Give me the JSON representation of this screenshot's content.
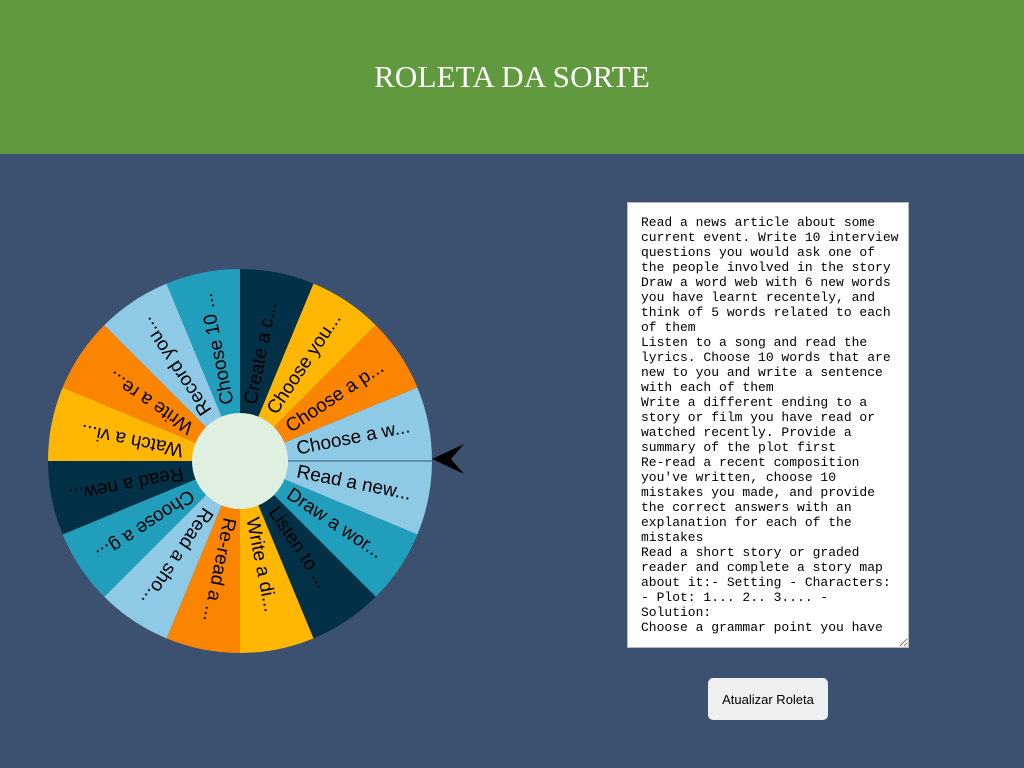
{
  "header": {
    "title": "ROLETA DA SORTE",
    "background": "#619a3e"
  },
  "page": {
    "background": "#3c5170"
  },
  "wheel": {
    "center_color": "#e0f0e0",
    "segments": [
      {
        "label": "Create a c...",
        "color": "#023047",
        "text_color": "#000000"
      },
      {
        "label": "Choose you...",
        "color": "#ffb703",
        "text_color": "#000000"
      },
      {
        "label": "Choose a p...",
        "color": "#fb8500",
        "text_color": "#000000"
      },
      {
        "label": "Choose a w...",
        "color": "#8ecae6",
        "text_color": "#000000"
      },
      {
        "label": "Read a new...",
        "color": "#8ecae6",
        "text_color": "#000000"
      },
      {
        "label": "Draw a wor...",
        "color": "#219ebc",
        "text_color": "#000000"
      },
      {
        "label": "Listen to ...",
        "color": "#023047",
        "text_color": "#000000"
      },
      {
        "label": "Write a di...",
        "color": "#ffb703",
        "text_color": "#000000"
      },
      {
        "label": "Re-read a ...",
        "color": "#fb8500",
        "text_color": "#000000"
      },
      {
        "label": "Read a sho...",
        "color": "#8ecae6",
        "text_color": "#000000"
      },
      {
        "label": "Choose a g...",
        "color": "#219ebc",
        "text_color": "#000000"
      },
      {
        "label": "Read a new...",
        "color": "#023047",
        "text_color": "#000000"
      },
      {
        "label": "Watch a vi...",
        "color": "#ffb703",
        "text_color": "#000000"
      },
      {
        "label": "Write a re...",
        "color": "#fb8500",
        "text_color": "#000000"
      },
      {
        "label": "Record you...",
        "color": "#8ecae6",
        "text_color": "#000000"
      },
      {
        "label": "Choose 10 ...",
        "color": "#219ebc",
        "text_color": "#000000"
      }
    ],
    "pointer_icon": "arrow-pointer-left"
  },
  "tasks": {
    "text": "Read a news article about some current event. Write 10 interview questions you would ask one of the people involved in the story\nDraw a word web with 6 new words you have learnt recentely, and think of 5 words related to each of them\nListen to a song and read the lyrics. Choose 10 words that are new to you and write a sentence with each of them\nWrite a different ending to a story or film you have read or watched recently. Provide a summary of the plot first\nRe-read a recent composition you've written, choose 10 mistakes you made, and provide the correct answers with an explanation for each of the mistakes\nRead a short story or graded reader and complete a story map about it:- Setting - Characters: - Plot: 1... 2.. 3.... - Solution:\nChoose a grammar point you have"
  },
  "controls": {
    "update_label": "Atualizar Roleta"
  }
}
